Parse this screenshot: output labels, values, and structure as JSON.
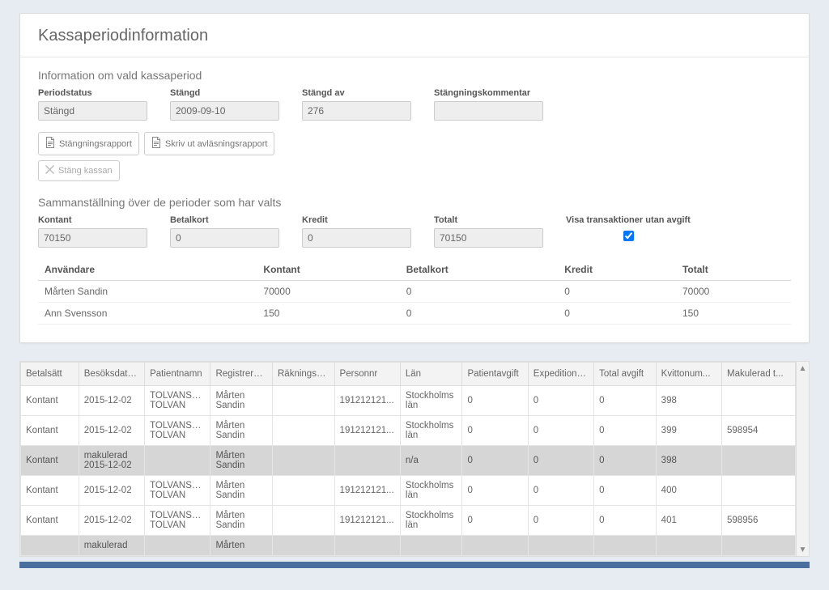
{
  "page": {
    "title": "Kassaperiodinformation"
  },
  "info": {
    "section_title": "Information om vald kassaperiod",
    "periodstatus_label": "Periodstatus",
    "periodstatus_value": "Stängd",
    "stangd_label": "Stängd",
    "stangd_value": "2009-09-10",
    "stangd_av_label": "Stängd av",
    "stangd_av_value": "276",
    "kommentar_label": "Stängningskommentar",
    "kommentar_value": ""
  },
  "buttons": {
    "stangningsrapport": "Stängningsrapport",
    "skriv_ut": "Skriv ut avläsningsrapport",
    "stang_kassan": "Stäng kassan"
  },
  "summary": {
    "section_title": "Sammanställning över de perioder som har valts",
    "kontant_label": "Kontant",
    "kontant_value": "70150",
    "betalkort_label": "Betalkort",
    "betalkort_value": "0",
    "kredit_label": "Kredit",
    "kredit_value": "0",
    "totalt_label": "Totalt",
    "totalt_value": "70150",
    "visa_label": "Visa transaktioner utan avgift",
    "visa_checked": true,
    "headers": {
      "anvandare": "Användare",
      "kontant": "Kontant",
      "betalkort": "Betalkort",
      "kredit": "Kredit",
      "totalt": "Totalt"
    },
    "rows": [
      {
        "anvandare": "Mårten Sandin",
        "kontant": "70000",
        "betalkort": "0",
        "kredit": "0",
        "totalt": "70000"
      },
      {
        "anvandare": "Ann Svensson",
        "kontant": "150",
        "betalkort": "0",
        "kredit": "0",
        "totalt": "150"
      }
    ]
  },
  "grid": {
    "headers": {
      "betalsatt": "Betalsätt",
      "besoksdatum": "Besöksdatum",
      "patientnamn": "Patientnamn",
      "registrerat": "Registrerat ...",
      "rakningsnu": "Räkningsnu...",
      "personnr": "Personnr",
      "lan": "Län",
      "patientavgift": "Patientavgift",
      "expeditions": "Expeditions...",
      "total_avgift": "Total avgift",
      "kvittonum": "Kvittonum...",
      "makulerad": "Makulerad t..."
    },
    "rows": [
      {
        "betalsatt": "Kontant",
        "besoksdatum": "2015-12-02",
        "patientnamn": "TOLVANSS... TOLVAN",
        "registrerat": "Mårten Sandin",
        "rakningsnu": "",
        "personnr": "191212121...",
        "lan": "Stockholms län",
        "patientavgift": "0",
        "expeditions": "0",
        "total_avgift": "0",
        "kvittonum": "398",
        "makulerad": "",
        "cancelled": false
      },
      {
        "betalsatt": "Kontant",
        "besoksdatum": "2015-12-02",
        "patientnamn": "TOLVANSS... TOLVAN",
        "registrerat": "Mårten Sandin",
        "rakningsnu": "",
        "personnr": "191212121...",
        "lan": "Stockholms län",
        "patientavgift": "0",
        "expeditions": "0",
        "total_avgift": "0",
        "kvittonum": "399",
        "makulerad": "598954",
        "cancelled": false
      },
      {
        "betalsatt": "Kontant",
        "besoksdatum": "makulerad\n2015-12-02",
        "patientnamn": "",
        "registrerat": "Mårten Sandin",
        "rakningsnu": "",
        "personnr": "",
        "lan": "n/a",
        "patientavgift": "0",
        "expeditions": "0",
        "total_avgift": "0",
        "kvittonum": "398",
        "makulerad": "",
        "cancelled": true
      },
      {
        "betalsatt": "Kontant",
        "besoksdatum": "2015-12-02",
        "patientnamn": "TOLVANSS... TOLVAN",
        "registrerat": "Mårten Sandin",
        "rakningsnu": "",
        "personnr": "191212121...",
        "lan": "Stockholms län",
        "patientavgift": "0",
        "expeditions": "0",
        "total_avgift": "0",
        "kvittonum": "400",
        "makulerad": "",
        "cancelled": false
      },
      {
        "betalsatt": "Kontant",
        "besoksdatum": "2015-12-02",
        "patientnamn": "TOLVANSS... TOLVAN",
        "registrerat": "Mårten Sandin",
        "rakningsnu": "",
        "personnr": "191212121...",
        "lan": "Stockholms län",
        "patientavgift": "0",
        "expeditions": "0",
        "total_avgift": "0",
        "kvittonum": "401",
        "makulerad": "598956",
        "cancelled": false
      },
      {
        "betalsatt": "",
        "besoksdatum": "makulerad",
        "patientnamn": "",
        "registrerat": "Mårten",
        "rakningsnu": "",
        "personnr": "",
        "lan": "",
        "patientavgift": "",
        "expeditions": "",
        "total_avgift": "",
        "kvittonum": "",
        "makulerad": "",
        "cancelled": true
      }
    ]
  }
}
